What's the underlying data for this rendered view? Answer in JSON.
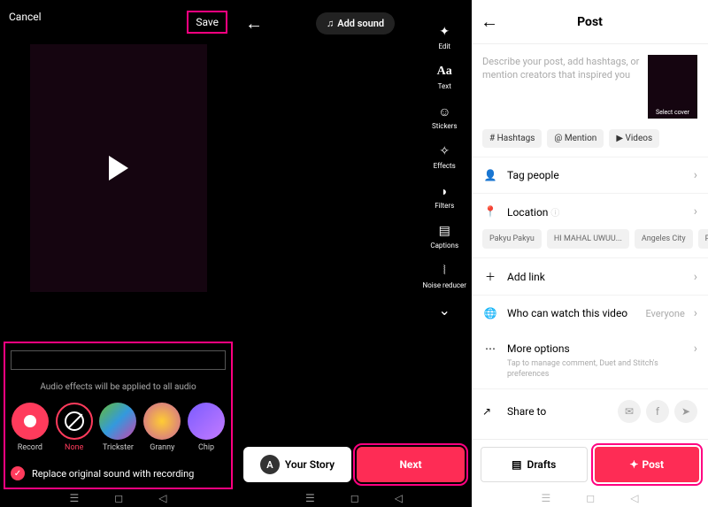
{
  "screen1": {
    "cancel": "Cancel",
    "save": "Save",
    "hint": "Audio effects will be applied to all audio",
    "effects": [
      {
        "label": "Record"
      },
      {
        "label": "None"
      },
      {
        "label": "Trickster"
      },
      {
        "label": "Granny"
      },
      {
        "label": "Chip"
      }
    ],
    "replace": "Replace original sound with recording"
  },
  "screen2": {
    "add_sound": "Add sound",
    "tools": [
      {
        "label": "Edit",
        "icon": "✦"
      },
      {
        "label": "Text",
        "icon": "Aa"
      },
      {
        "label": "Stickers",
        "icon": "☺"
      },
      {
        "label": "Effects",
        "icon": "✧"
      },
      {
        "label": "Filters",
        "icon": "◗"
      },
      {
        "label": "Captions",
        "icon": "▤"
      },
      {
        "label": "Noise reducer",
        "icon": "⦚"
      }
    ],
    "your_story": "Your Story",
    "next": "Next"
  },
  "screen3": {
    "title": "Post",
    "placeholder": "Describe your post, add hashtags, or mention creators that inspired you",
    "cover": "Select cover",
    "chips": {
      "hashtags": "# Hashtags",
      "mention": "@ Mention",
      "videos": "▶ Videos"
    },
    "tag_people": "Tag people",
    "location": "Location",
    "locations": [
      "Pakyu Pakyu",
      "HI MAHAL UWUU...",
      "Angeles City",
      "Pa"
    ],
    "add_link": "Add link",
    "who_watch": "Who can watch this video",
    "who_value": "Everyone",
    "more": "More options",
    "more_sub": "Tap to manage comment, Duet and Stitch's preferences",
    "share": "Share to",
    "drafts": "Drafts",
    "post": "Post"
  }
}
